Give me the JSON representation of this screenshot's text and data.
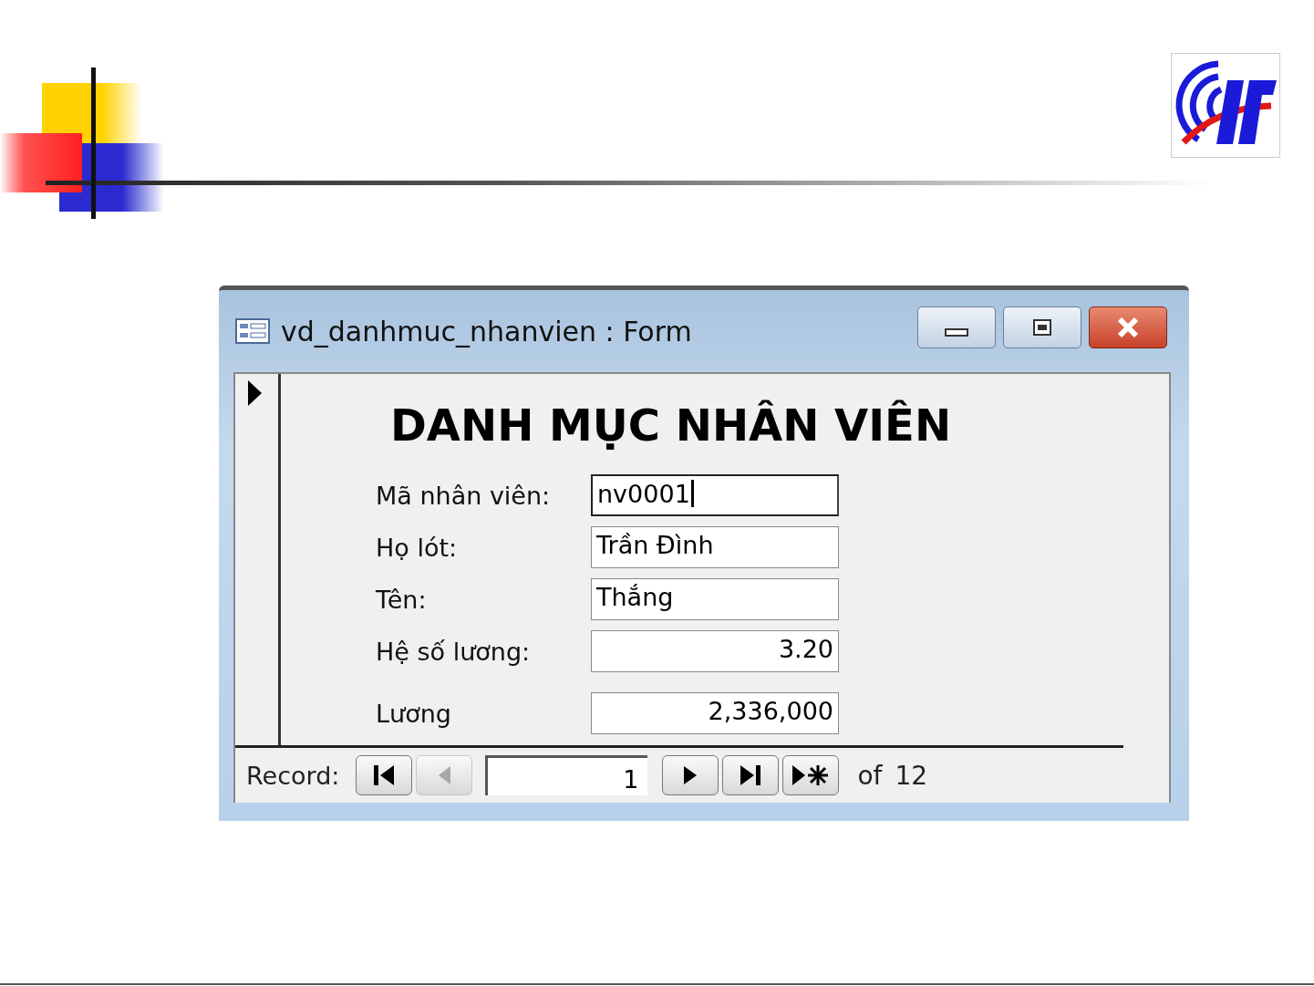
{
  "window": {
    "title": "vd_danhmuc_nhanvien : Form"
  },
  "form": {
    "heading": "DANH MỤC NHÂN VIÊN",
    "current_record": true,
    "fields": [
      {
        "label": "Mã nhân viên:",
        "value": "nv0001",
        "kind": "text",
        "focused": true
      },
      {
        "label": "Họ lót:",
        "value": "Trần Đình",
        "kind": "text",
        "focused": false
      },
      {
        "label": "Tên:",
        "value": "Thắng",
        "kind": "text",
        "focused": false
      },
      {
        "label": "Hệ số lương:",
        "value": "3.20",
        "kind": "number",
        "focused": false
      },
      {
        "label": "Lương",
        "value": "2,336,000",
        "kind": "number",
        "focused": false
      }
    ]
  },
  "navigation": {
    "label": "Record:",
    "buttons_before": [
      {
        "kind": "first",
        "disabled": false
      },
      {
        "kind": "previous",
        "disabled": true
      }
    ],
    "record_number": "1",
    "buttons_after": [
      {
        "kind": "next",
        "disabled": false
      },
      {
        "kind": "last",
        "disabled": false
      },
      {
        "kind": "new",
        "disabled": false
      }
    ],
    "of_label": "of",
    "total": "12"
  }
}
